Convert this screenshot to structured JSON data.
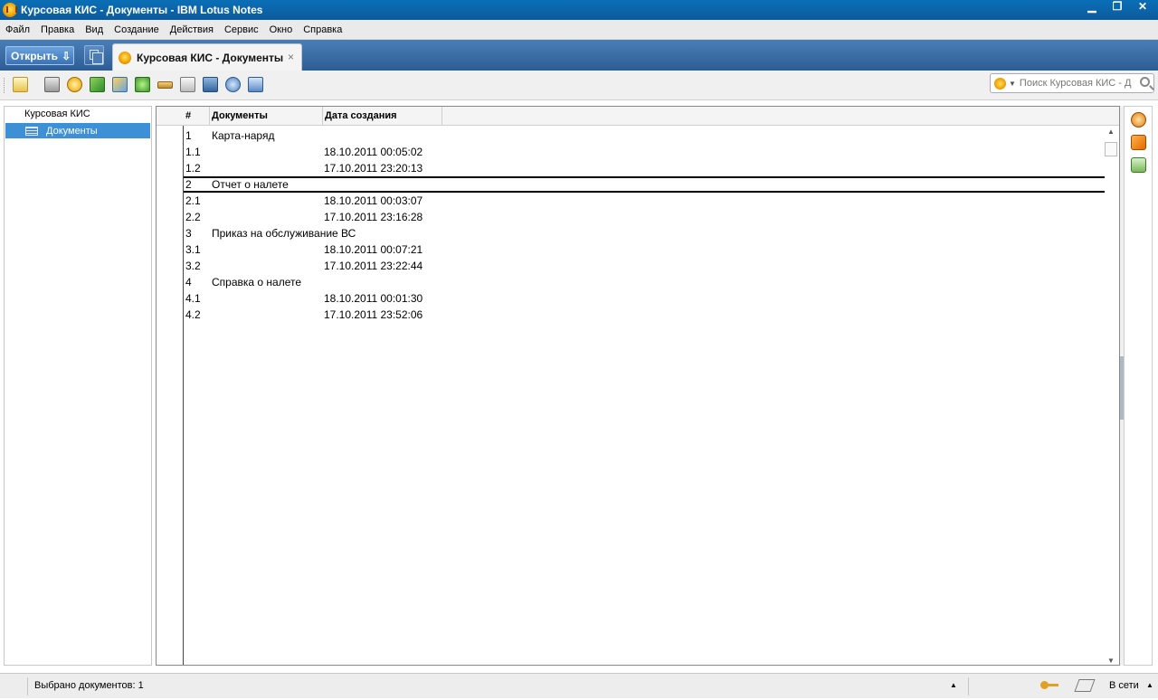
{
  "window": {
    "title": "Курсовая КИС - Документы - IBM Lotus Notes",
    "minimize_label": "▁",
    "restore_label": "❐",
    "close_label": "✕"
  },
  "menu": [
    "Файл",
    "Правка",
    "Вид",
    "Создание",
    "Действия",
    "Сервис",
    "Окно",
    "Справка"
  ],
  "tabs": {
    "open_label": "Открыть",
    "open_icon": "⇩",
    "active_tab_label": "Курсовая КИС - Документы",
    "close_icon": "×"
  },
  "toolbar": {
    "icons": [
      "new-memo-icon",
      "print-icon",
      "stop-icon",
      "next-unread-icon",
      "previous-unread-icon",
      "add-icon",
      "mark-icon",
      "copy-icon",
      "find-icon",
      "refresh-icon",
      "properties-icon"
    ],
    "search_placeholder": "Поиск Курсовая КИС - Д"
  },
  "navigator": {
    "root_label": "Курсовая КИС",
    "selected_item_label": "Документы"
  },
  "view": {
    "columns": [
      "#",
      "Документы",
      "Дата создания"
    ],
    "rows": [
      {
        "num": "1",
        "doc": "Карта-наряд",
        "date": ""
      },
      {
        "num": "1.1",
        "doc": "",
        "date": "18.10.2011 00:05:02"
      },
      {
        "num": "1.2",
        "doc": "",
        "date": "17.10.2011 23:20:13"
      },
      {
        "num": "2",
        "doc": "Отчет о налете",
        "date": ""
      },
      {
        "num": "2.1",
        "doc": "",
        "date": "18.10.2011 00:03:07"
      },
      {
        "num": "2.2",
        "doc": "",
        "date": "17.10.2011 23:16:28"
      },
      {
        "num": "3",
        "doc": "Приказ на обслуживание ВС",
        "date": ""
      },
      {
        "num": "3.1",
        "doc": "",
        "date": "18.10.2011 00:07:21"
      },
      {
        "num": "3.2",
        "doc": "",
        "date": "17.10.2011 23:22:44"
      },
      {
        "num": "4",
        "doc": "Справка о налете",
        "date": ""
      },
      {
        "num": "4.1",
        "doc": "",
        "date": "18.10.2011 00:01:30"
      },
      {
        "num": "4.2",
        "doc": "",
        "date": "17.10.2011 23:52:06"
      }
    ],
    "selected_row_index": 3
  },
  "status": {
    "selected_text": "Выбрано документов: 1",
    "location": "В сети"
  },
  "colors": {
    "title_bar": "#0d5a9c",
    "tab_strip": "#2e5d95",
    "selection": "#3d8fd6"
  }
}
